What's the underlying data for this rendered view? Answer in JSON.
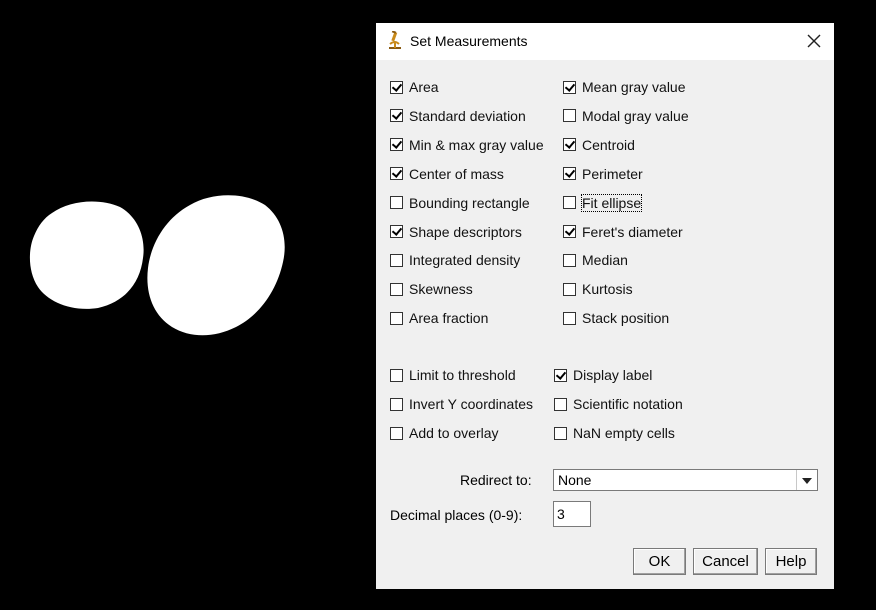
{
  "dialog": {
    "title": "Set Measurements",
    "icon": "microscope-icon",
    "close_icon": "close-icon"
  },
  "measurements": {
    "left": [
      {
        "label": "Area",
        "checked": true
      },
      {
        "label": "Standard deviation",
        "checked": true
      },
      {
        "label": "Min & max gray value",
        "checked": true
      },
      {
        "label": "Center of mass",
        "checked": true
      },
      {
        "label": "Bounding rectangle",
        "checked": false
      },
      {
        "label": "Shape descriptors",
        "checked": true
      },
      {
        "label": "Integrated density",
        "checked": false
      },
      {
        "label": "Skewness",
        "checked": false
      },
      {
        "label": "Area fraction",
        "checked": false
      }
    ],
    "right": [
      {
        "label": "Mean gray value",
        "checked": true
      },
      {
        "label": "Modal gray value",
        "checked": false
      },
      {
        "label": "Centroid",
        "checked": true
      },
      {
        "label": "Perimeter",
        "checked": true
      },
      {
        "label": "Fit ellipse",
        "checked": false,
        "focused": true
      },
      {
        "label": "Feret's diameter",
        "checked": true
      },
      {
        "label": "Median",
        "checked": false
      },
      {
        "label": "Kurtosis",
        "checked": false
      },
      {
        "label": "Stack position",
        "checked": false
      }
    ]
  },
  "options": {
    "left": [
      {
        "label": "Limit to threshold",
        "checked": false
      },
      {
        "label": "Invert Y coordinates",
        "checked": false
      },
      {
        "label": "Add to overlay",
        "checked": false
      }
    ],
    "right": [
      {
        "label": "Display label",
        "checked": true
      },
      {
        "label": "Scientific notation",
        "checked": false
      },
      {
        "label": "NaN empty cells",
        "checked": false
      }
    ]
  },
  "redirect": {
    "label": "Redirect to:",
    "value": "None"
  },
  "decimal": {
    "label": "Decimal places (0-9):",
    "value": "3"
  },
  "buttons": {
    "ok": "OK",
    "cancel": "Cancel",
    "help": "Help"
  }
}
